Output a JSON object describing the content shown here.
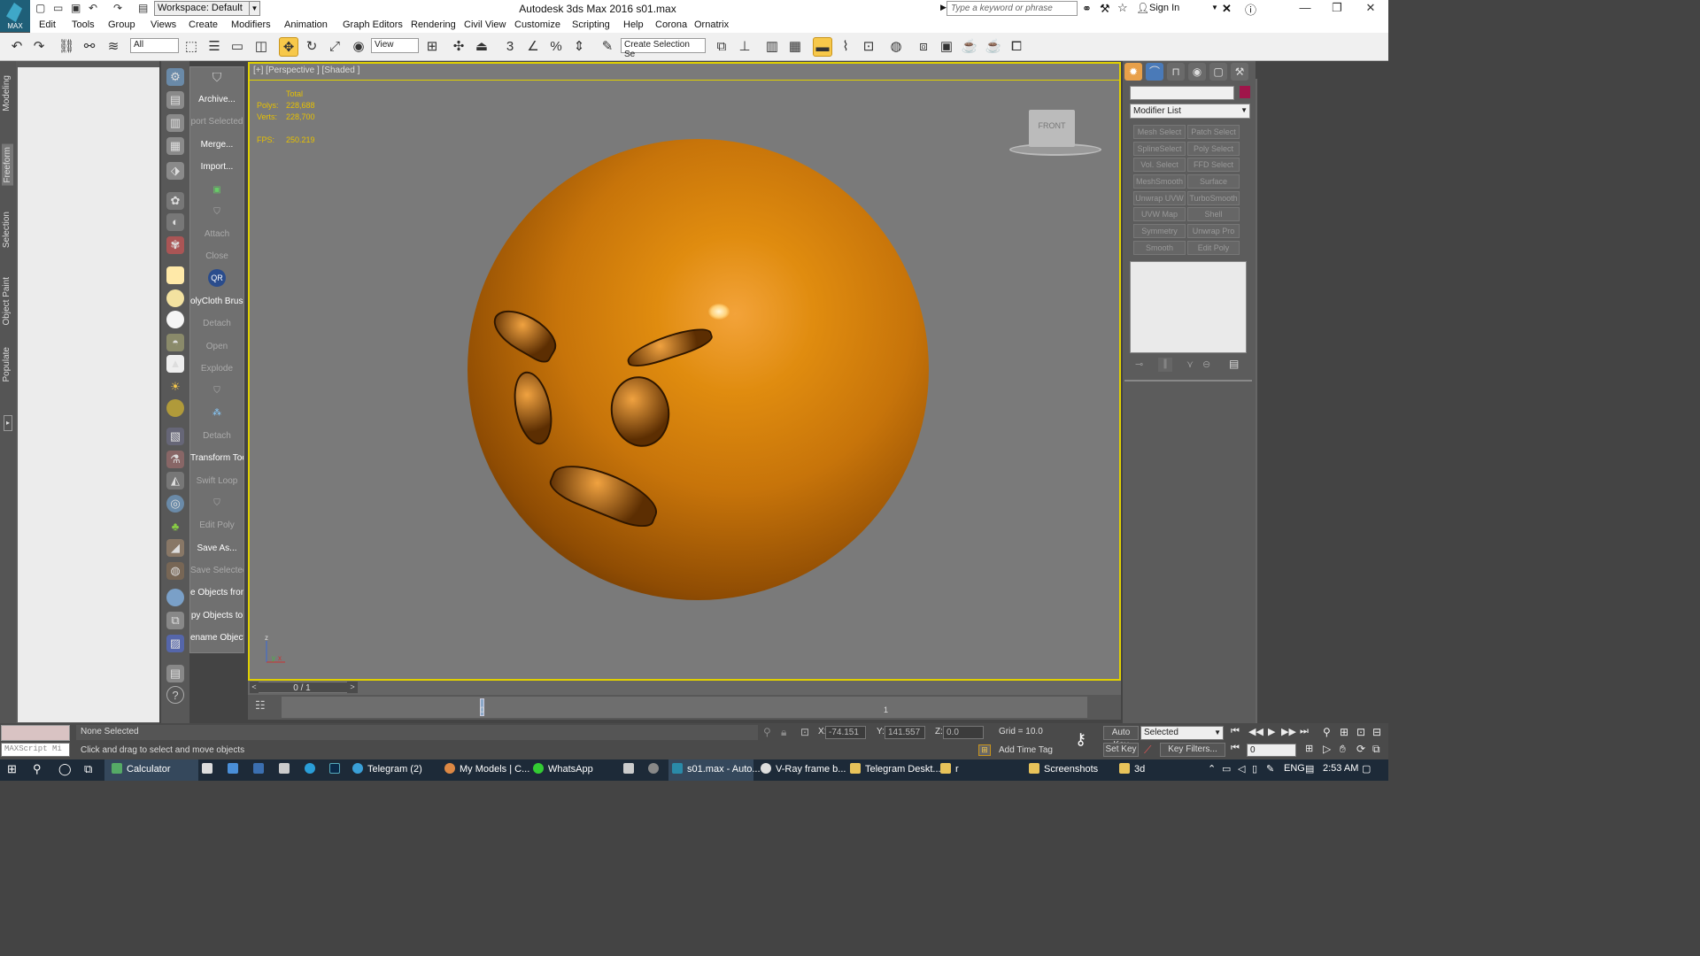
{
  "app": {
    "logo_label": "MAX",
    "workspace": "Workspace: Default",
    "window_title": "Autodesk 3ds Max 2016     s01.max",
    "search_placeholder": "Type a keyword or phrase",
    "sign_in": "Sign In"
  },
  "menu": [
    "Edit",
    "Tools",
    "Group",
    "Views",
    "Create",
    "Modifiers",
    "Animation",
    "Graph Editors",
    "Rendering",
    "Civil View",
    "Customize",
    "Scripting",
    "Help",
    "Corona",
    "Ornatrix"
  ],
  "toolbar": {
    "filter": "All",
    "coord": "View",
    "selection_set": "Create Selection Se"
  },
  "left_tabs": [
    "Modeling",
    "Freeform",
    "Selection",
    "Object Paint",
    "Populate"
  ],
  "tool_buttons": [
    {
      "label": "Archive...",
      "enabled": true
    },
    {
      "label": "port Selected",
      "enabled": false
    },
    {
      "label": "Merge...",
      "enabled": true
    },
    {
      "label": "Import...",
      "enabled": true
    },
    {
      "label": "",
      "enabled": true
    },
    {
      "label": "",
      "enabled": true
    },
    {
      "label": "Attach",
      "enabled": false
    },
    {
      "label": "Close",
      "enabled": false
    },
    {
      "label": "QR",
      "enabled": true
    },
    {
      "label": "olyCloth Brush",
      "enabled": true
    },
    {
      "label": "Detach",
      "enabled": false
    },
    {
      "label": "Open",
      "enabled": false
    },
    {
      "label": "Explode",
      "enabled": false
    },
    {
      "label": "",
      "enabled": true
    },
    {
      "label": "",
      "enabled": true
    },
    {
      "label": "Detach",
      "enabled": false
    },
    {
      "label": "Transform Tool",
      "enabled": true
    },
    {
      "label": "Swift Loop",
      "enabled": false
    },
    {
      "label": "",
      "enabled": true
    },
    {
      "label": "Edit Poly",
      "enabled": false
    },
    {
      "label": "Save As...",
      "enabled": true
    },
    {
      "label": "Save Selected",
      "enabled": false
    },
    {
      "label": "e Objects fron",
      "enabled": true
    },
    {
      "label": "py Objects to",
      "enabled": true
    },
    {
      "label": "ename Objects",
      "enabled": true
    }
  ],
  "viewport": {
    "label": "[+] [Perspective ] [Shaded ]",
    "stats_header": "Total",
    "polys_label": "Polys:",
    "polys": "228,688",
    "verts_label": "Verts:",
    "verts": "228,700",
    "fps_label": "FPS:",
    "fps": "250.219",
    "viewcube": "FRONT"
  },
  "timeline": {
    "frame": "0 / 1",
    "tick_0": "0",
    "tick_1": "1"
  },
  "modifiers": {
    "list_label": "Modifier List",
    "buttons": [
      "Mesh Select",
      "Patch Select",
      "SplineSelect",
      "Poly Select",
      "Vol. Select",
      "FFD Select",
      "MeshSmooth",
      "Surface Select",
      "Unwrap UVW",
      "TurboSmooth",
      "UVW Map",
      "Shell",
      "Symmetry",
      "Unwrap Pro",
      "Smooth",
      "Edit Poly"
    ]
  },
  "status": {
    "script_label": "MAXScript Mi",
    "selection": "None Selected",
    "prompt": "Click and drag to select and move objects",
    "x_label": "X:",
    "x": "-74.151",
    "y_label": "Y:",
    "y": "141.557",
    "z_label": "Z:",
    "z": "0.0",
    "grid": "Grid = 10.0",
    "add_time_tag": "Add Time Tag",
    "auto_key": "Auto Key",
    "set_key": "Set Key",
    "key_mode": "Selected",
    "key_filters": "Key Filters...",
    "frame_value": "0"
  },
  "taskbar": {
    "items": [
      "Calculator",
      "Telegram (2)",
      "My Models | C...",
      "WhatsApp",
      "s01.max - Auto...",
      "V-Ray frame b...",
      "Telegram Deskt...",
      "r",
      "Screenshots",
      "3d"
    ],
    "lang": "ENG",
    "time": "2:53 AM"
  }
}
